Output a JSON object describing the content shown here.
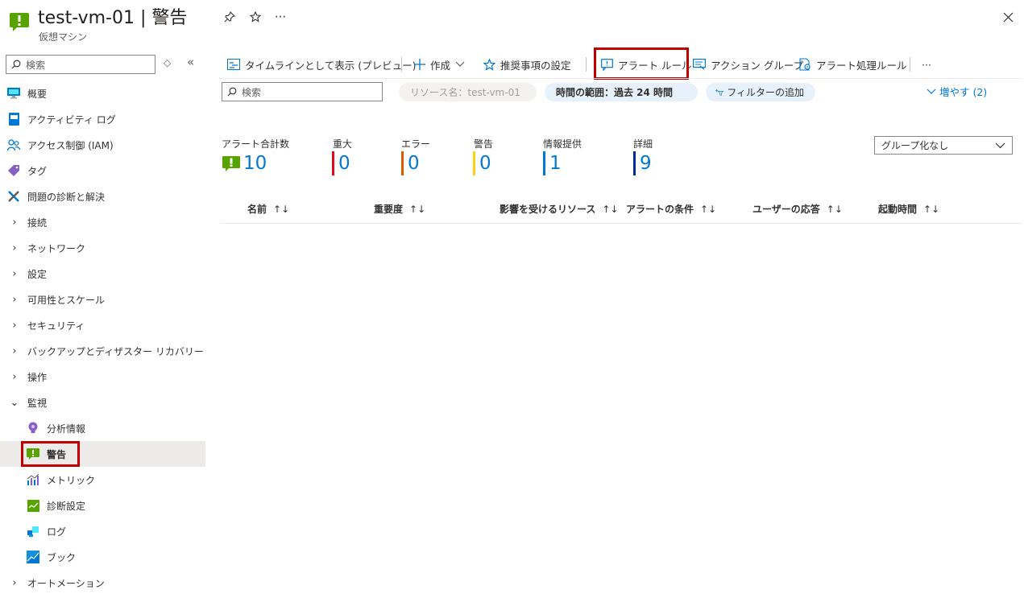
{
  "header": {
    "title": "test-vm-01 | 警告",
    "subtitle": "仮想マシン",
    "more_label": "···"
  },
  "sidebar": {
    "search_placeholder": "検索",
    "items": [
      {
        "label": "概要",
        "icon": "monitor-icon"
      },
      {
        "label": "アクティビティ ログ",
        "icon": "log-book-icon"
      },
      {
        "label": "アクセス制御 (IAM)",
        "icon": "people-icon"
      },
      {
        "label": "タグ",
        "icon": "tag-icon"
      },
      {
        "label": "問題の診断と解決",
        "icon": "wrench-icon"
      },
      {
        "label": "接続",
        "icon": "chevron-right-icon"
      },
      {
        "label": "ネットワーク",
        "icon": "chevron-right-icon"
      },
      {
        "label": "設定",
        "icon": "chevron-right-icon"
      },
      {
        "label": "可用性とスケール",
        "icon": "chevron-right-icon"
      },
      {
        "label": "セキュリティ",
        "icon": "chevron-right-icon"
      },
      {
        "label": "バックアップとディザスター リカバリー",
        "icon": "chevron-right-icon"
      },
      {
        "label": "操作",
        "icon": "chevron-right-icon"
      },
      {
        "label": "監視",
        "icon": "chevron-down-icon"
      },
      {
        "label": "分析情報",
        "icon": "bulb-icon"
      },
      {
        "label": "警告",
        "icon": "alert-icon"
      },
      {
        "label": "メトリック",
        "icon": "metrics-icon"
      },
      {
        "label": "診断設定",
        "icon": "diagnostic-icon"
      },
      {
        "label": "ログ",
        "icon": "logs-icon"
      },
      {
        "label": "ブック",
        "icon": "workbook-icon"
      },
      {
        "label": "オートメーション",
        "icon": "chevron-right-icon"
      }
    ]
  },
  "toolbar": {
    "timeline": "タイムラインとして表示 (プレビュー)",
    "create": "作成",
    "recommend": "推奨事項の設定",
    "alert_rules": "アラート ルール",
    "action_groups": "アクション グループ",
    "processing_rules": "アラート処理ルール",
    "more": "···"
  },
  "filters": {
    "search_placeholder": "検索",
    "resource": "リソース名：test-vm-01",
    "time_range": "時間の範囲：過去 24 時間",
    "add_filter": "フィルターの追加",
    "more": "増やす (2)"
  },
  "summary": {
    "total_label": "アラート合計数",
    "total_value": "10",
    "severities": [
      {
        "label": "重大",
        "value": "0",
        "color": "#e00b1c"
      },
      {
        "label": "エラー",
        "value": "0",
        "color": "#da5b00"
      },
      {
        "label": "警告",
        "value": "0",
        "color": "#fcd116"
      },
      {
        "label": "情報提供",
        "value": "1",
        "color": "#0078d4"
      },
      {
        "label": "詳細",
        "value": "9",
        "color": "#002b9a"
      }
    ],
    "group_by": "グループ化なし"
  },
  "table": {
    "columns": [
      "名前",
      "重要度",
      "影響を受けるリソース",
      "アラートの条件",
      "ユーザーの応答",
      "起動時間"
    ],
    "sort_glyph": "↑↓"
  },
  "colors": {
    "accent": "#0078d4",
    "highlight": "#c00000",
    "alert_green": "#57a300"
  }
}
